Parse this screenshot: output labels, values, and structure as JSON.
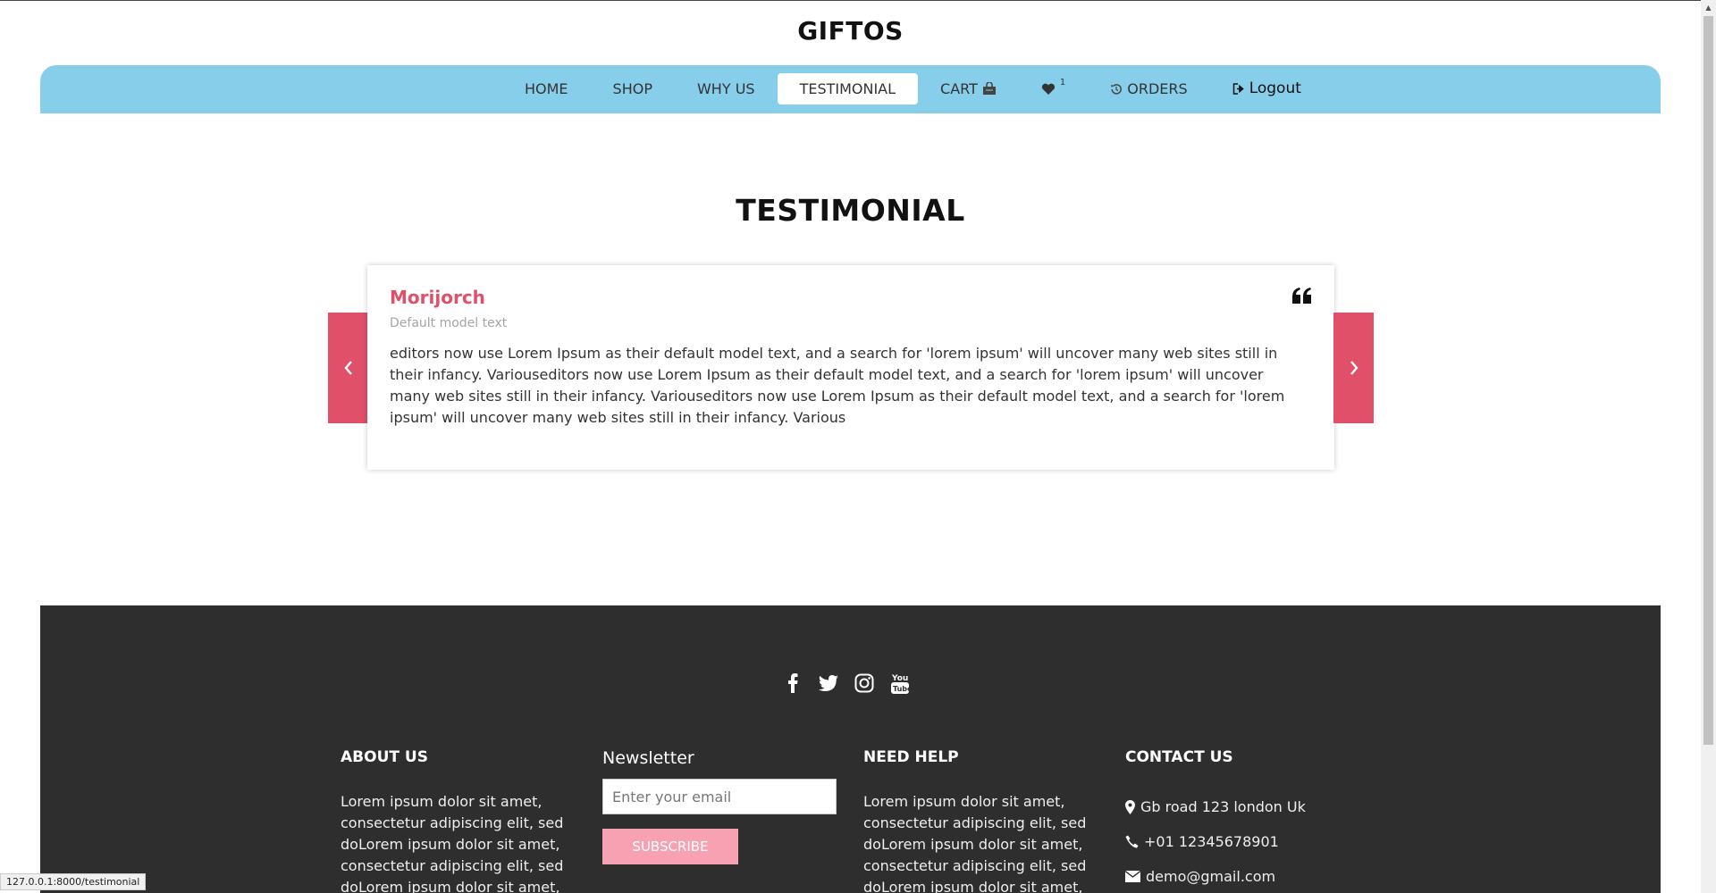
{
  "brand": "GIFTOS",
  "nav": {
    "home": "HOME",
    "shop": "SHOP",
    "why_us": "WHY US",
    "testimonial": "TESTIMONIAL",
    "cart": "CART",
    "wishlist_count": "1",
    "orders": "ORDERS",
    "logout": "Logout"
  },
  "section": {
    "title": "TESTIMONIAL"
  },
  "testimonial": {
    "name": "Morijorch",
    "role": "Default model text",
    "text": "editors now use Lorem Ipsum as their default model text, and a search for 'lorem ipsum' will uncover many web sites still in their infancy. Variouseditors now use Lorem Ipsum as their default model text, and a search for 'lorem ipsum' will uncover many web sites still in their infancy. Variouseditors now use Lorem Ipsum as their default model text, and a search for 'lorem ipsum' will uncover many web sites still in their infancy. Various"
  },
  "footer": {
    "about": {
      "title": "ABOUT US",
      "text": "Lorem ipsum dolor sit amet, consectetur adipiscing elit, sed doLorem ipsum dolor sit amet, consectetur adipiscing elit, sed doLorem ipsum dolor sit amet,"
    },
    "newsletter": {
      "title": "Newsletter",
      "placeholder": "Enter your email",
      "button": "SUBSCRIBE"
    },
    "help": {
      "title": "NEED HELP",
      "text": "Lorem ipsum dolor sit amet, consectetur adipiscing elit, sed doLorem ipsum dolor sit amet, consectetur adipiscing elit, sed doLorem ipsum dolor sit amet,"
    },
    "contact": {
      "title": "CONTACT US",
      "address": "Gb road 123 london Uk",
      "phone": "+01 12345678901",
      "email": "demo@gmail.com"
    },
    "social": [
      "facebook-icon",
      "twitter-icon",
      "instagram-icon",
      "youtube-icon"
    ]
  },
  "status_url": "127.0.0.1:8000/testimonial",
  "colors": {
    "nav_bg": "#87ceeb",
    "accent": "#e05169",
    "footer_bg": "#2e2e2e",
    "subscribe": "#f6a2b2"
  }
}
